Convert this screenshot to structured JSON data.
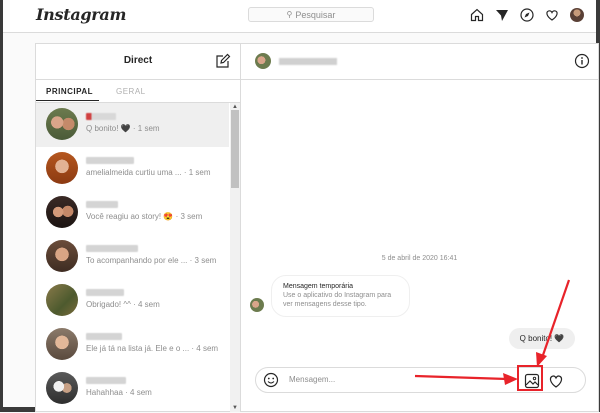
{
  "app": {
    "logo_text": "Instagram"
  },
  "search": {
    "placeholder": "Pesquisar",
    "icon": "search-icon"
  },
  "nav_icons": [
    "home-icon",
    "direct-icon",
    "explore-icon",
    "heart-icon",
    "avatar"
  ],
  "direct": {
    "title": "Direct",
    "tabs": [
      {
        "label": "PRINCIPAL",
        "active": true
      },
      {
        "label": "GERAL",
        "active": false
      }
    ]
  },
  "threads": [
    {
      "message": "Q bonito! 🖤",
      "time": "· 1 sem",
      "active": true
    },
    {
      "message": "amelialmeida curtiu uma ...",
      "time": "· 1 sem"
    },
    {
      "message": "Você reagiu ao story! 😍",
      "time": "· 3 sem"
    },
    {
      "message": "To acompanhando por ele ...",
      "time": "· 3 sem"
    },
    {
      "message": "Obrigado! ^^",
      "time": "· 4 sem"
    },
    {
      "message": "Ele já tá na lista já. Ele e o ...",
      "time": "· 4 sem"
    },
    {
      "message": "Hahahhaa",
      "time": "· 4 sem"
    }
  ],
  "conversation": {
    "date": "5 de abril de 2020 16:41",
    "temp_title": "Mensagem temporária",
    "temp_body": "Use o aplicativo do Instagram para ver mensagens desse tipo.",
    "sent_message": "Q bonito! 🖤"
  },
  "composer": {
    "placeholder": "Mensagem..."
  },
  "colors": {
    "annotation": "#e8232a",
    "border": "#dbdbdb",
    "muted": "#8e8e8e"
  }
}
